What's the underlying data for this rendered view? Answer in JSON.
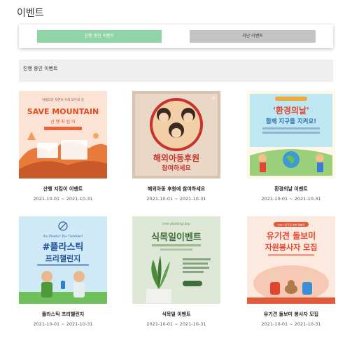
{
  "page": {
    "title": "이벤트"
  },
  "tabs": {
    "active_label": "진행 중인 이벤트",
    "past_label": "지난 이벤트"
  },
  "section": {
    "label": "진행 중인 이벤트"
  },
  "events": [
    {
      "title": "산행 지킴이 이벤트",
      "date": "2021-10-01 ~ 2021-10-31",
      "poster": {
        "heading": "SAVE MOUNTAIN",
        "subheading": "산 행 지 킴 이",
        "top_text": "아름다운 자연이 우리 모두의 것"
      }
    },
    {
      "title": "해외아동 후원에 참여하세요",
      "date": "2021-10-01 ~ 2021-10-31",
      "poster": {
        "heading": "해외아동후원",
        "subheading": "참여하세요"
      }
    },
    {
      "title": "환경의날 이벤트",
      "date": "2021-10-01 ~ 2021-10-31",
      "poster": {
        "heading": "'환경의날'",
        "subheading": "함께 지구를 지켜요!"
      }
    },
    {
      "title": "플라스틱 프리챌린지",
      "date": "2021-10-01 ~ 2021-10-31",
      "poster": {
        "heading": "#플라스틱",
        "subheading": "프리챌린지",
        "top_text": "No Plastic! Yes Tumbler!"
      }
    },
    {
      "title": "식목일 이벤트",
      "date": "2021-10-01 ~ 2021-10-31",
      "poster": {
        "heading": "식목일이벤트",
        "top_text": "tree planting day"
      }
    },
    {
      "title": "유기견 돌보미 봉사자 모집",
      "date": "2021-10-01 ~ 2021-10-31",
      "poster": {
        "heading": "유기견 돌보미",
        "subheading": "자원봉사자 모집",
        "top_text": "2021 유기견 보호 캠페인"
      }
    }
  ],
  "colors": {
    "tab_active": "#8fd4a6",
    "tab_past": "#c4c4c4",
    "section_bg": "#efefef"
  }
}
